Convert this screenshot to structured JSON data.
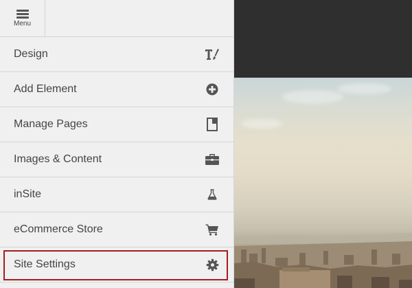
{
  "menu_button": {
    "label": "Menu",
    "icon": "hamburger-icon"
  },
  "items": [
    {
      "label": "Design",
      "icon": "typography-brush-icon",
      "selected": false
    },
    {
      "label": "Add Element",
      "icon": "plus-circle-icon",
      "selected": false
    },
    {
      "label": "Manage Pages",
      "icon": "page-icon",
      "selected": false
    },
    {
      "label": "Images & Content",
      "icon": "briefcase-icon",
      "selected": false
    },
    {
      "label": "inSite",
      "icon": "flask-icon",
      "selected": false
    },
    {
      "label": "eCommerce Store",
      "icon": "cart-icon",
      "selected": false
    },
    {
      "label": "Site Settings",
      "icon": "gear-icon",
      "selected": true
    }
  ],
  "colors": {
    "sidebar_bg": "#f0f0f0",
    "text": "#444444",
    "icon": "#555555",
    "selection_border": "#a31d1d",
    "header_dark": "#2f2f2f"
  }
}
